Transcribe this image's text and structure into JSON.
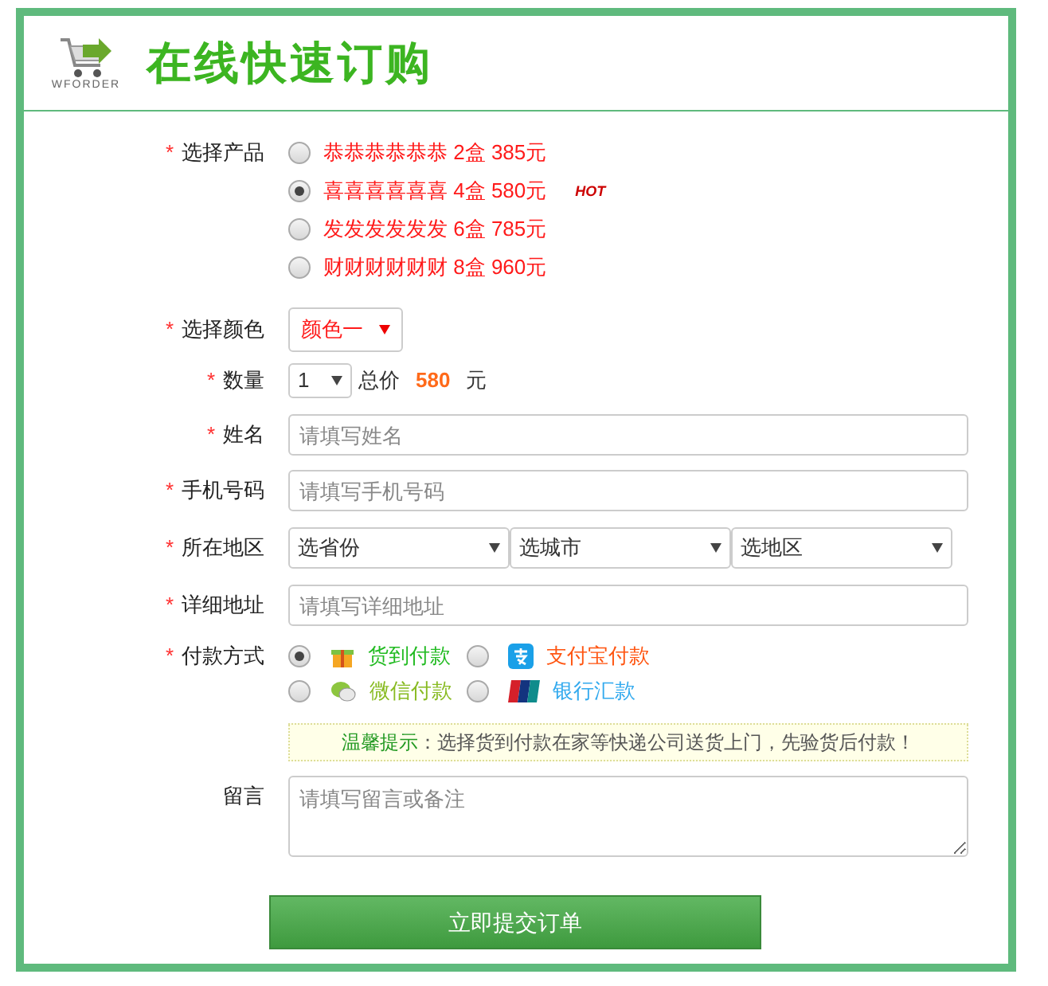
{
  "header": {
    "logo_text": "WFORDER",
    "title": "在线快速订购"
  },
  "products": {
    "required_mark": "*",
    "label": "选择产品",
    "options": [
      {
        "text": "恭恭恭恭恭恭 2盒 385元",
        "selected": false
      },
      {
        "text": "喜喜喜喜喜喜 4盒 580元",
        "selected": true,
        "badge": "HOT"
      },
      {
        "text": "发发发发发发 6盒 785元",
        "selected": false
      },
      {
        "text": "财财财财财财 8盒 960元",
        "selected": false
      }
    ]
  },
  "color": {
    "required_mark": "*",
    "label": "选择颜色",
    "value": "颜色一"
  },
  "quantity": {
    "required_mark": "*",
    "label": "数量",
    "value": "1",
    "total_label": "总价",
    "total": "580",
    "unit": "元"
  },
  "name": {
    "required_mark": "*",
    "label": "姓名",
    "placeholder": "请填写姓名"
  },
  "phone": {
    "required_mark": "*",
    "label": "手机号码",
    "placeholder": "请填写手机号码"
  },
  "region": {
    "required_mark": "*",
    "label": "所在地区",
    "selects": [
      "选省份",
      "选城市",
      "选地区"
    ]
  },
  "address": {
    "required_mark": "*",
    "label": "详细地址",
    "placeholder": "请填写详细地址"
  },
  "payment": {
    "required_mark": "*",
    "label": "付款方式",
    "options": [
      {
        "kind": "parcel",
        "text": "货到付款",
        "selected": true,
        "color": "#22bb22"
      },
      {
        "kind": "alipay",
        "text": "支付宝付款",
        "selected": false,
        "color": "#ff5511"
      },
      {
        "kind": "wechat",
        "text": "微信付款",
        "selected": false,
        "color": "#88bb22"
      },
      {
        "kind": "bank",
        "text": "银行汇款",
        "selected": false,
        "color": "#33aaee"
      }
    ]
  },
  "tip": {
    "label": "温馨提示",
    "text": "：选择货到付款在家等快递公司送货上门，先验货后付款！"
  },
  "message": {
    "label": "留言",
    "placeholder": "请填写留言或备注"
  },
  "submit": "立即提交订单"
}
